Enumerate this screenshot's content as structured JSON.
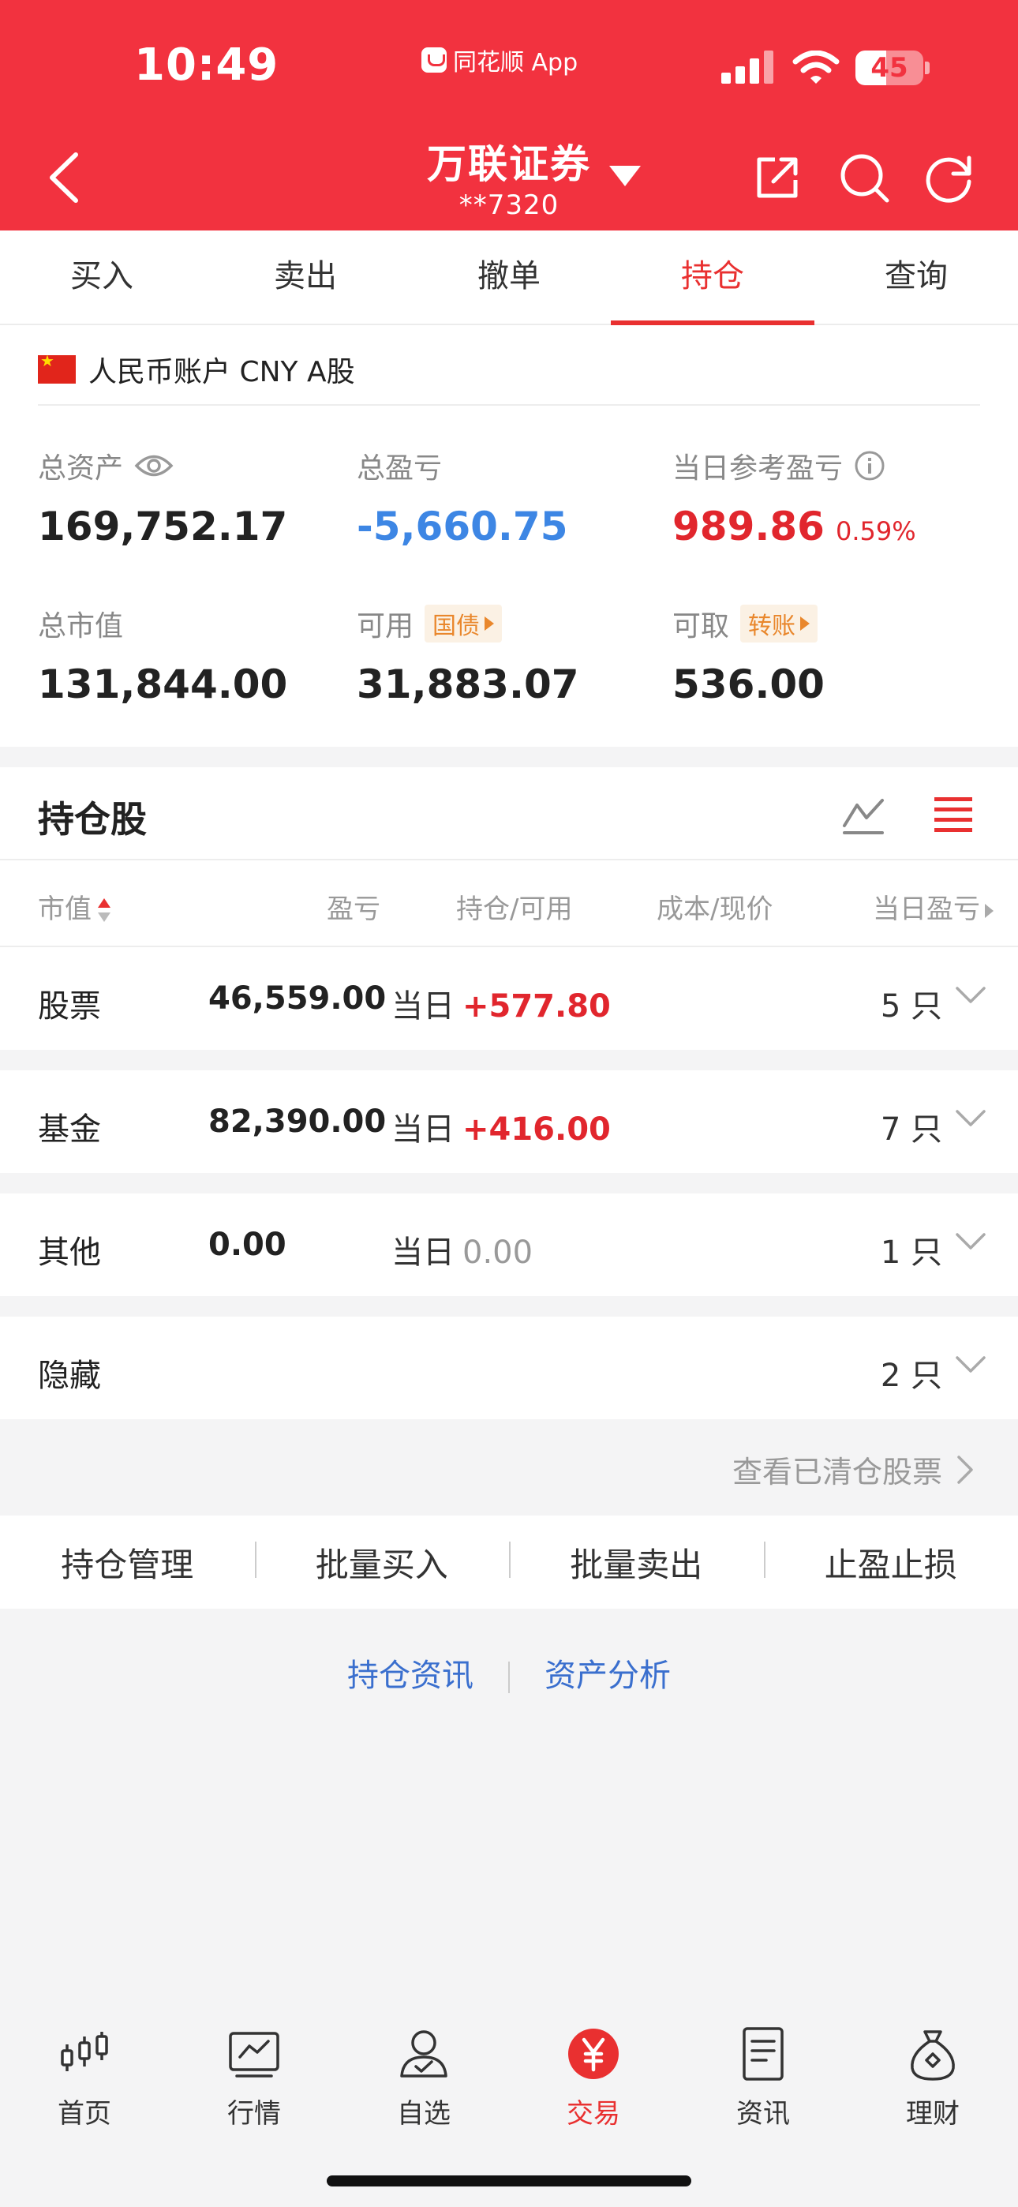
{
  "status_bar": {
    "time": "10:49",
    "app_label": "同花顺 App",
    "battery": "45",
    "battery_fraction": 0.45
  },
  "header": {
    "broker_name": "万联证券",
    "account_masked": "**7320"
  },
  "tabs": [
    {
      "label": "买入"
    },
    {
      "label": "卖出"
    },
    {
      "label": "撤单"
    },
    {
      "label": "持仓",
      "active": true
    },
    {
      "label": "查询"
    }
  ],
  "account": {
    "currency_line": "人民币账户 CNY A股",
    "total_assets": {
      "label": "总资产",
      "value": "169,752.17"
    },
    "total_pnl": {
      "label": "总盈亏",
      "value": "-5,660.75"
    },
    "daily_pnl": {
      "label": "当日参考盈亏",
      "value": "989.86",
      "pct": "0.59%"
    },
    "market_value": {
      "label": "总市值",
      "value": "131,844.00"
    },
    "available": {
      "label": "可用",
      "tag": "国债",
      "value": "31,883.07"
    },
    "withdrawable": {
      "label": "可取",
      "tag": "转账",
      "value": "536.00"
    }
  },
  "holdings": {
    "title": "持仓股",
    "columns": [
      "市值",
      "盈亏",
      "持仓/可用",
      "成本/现价",
      "当日盈亏"
    ],
    "categories": [
      {
        "name": "股票",
        "value": "46,559.00",
        "day_label": "当日",
        "day_value": "+577.80",
        "count": "5 只"
      },
      {
        "name": "基金",
        "value": "82,390.00",
        "day_label": "当日",
        "day_value": "+416.00",
        "count": "7 只"
      },
      {
        "name": "其他",
        "value": "0.00",
        "day_label": "当日",
        "day_value": "0.00",
        "count": "1 只"
      },
      {
        "name": "隐藏",
        "count": "2 只"
      }
    ],
    "cleared_link": "查看已清仓股票"
  },
  "actions": [
    "持仓管理",
    "批量买入",
    "批量卖出",
    "止盈止损"
  ],
  "info_links": [
    "持仓资讯",
    "资产分析"
  ],
  "tabbar": [
    {
      "label": "首页",
      "icon": "candlestick-icon"
    },
    {
      "label": "行情",
      "icon": "chart-icon"
    },
    {
      "label": "自选",
      "icon": "user-check-icon"
    },
    {
      "label": "交易",
      "icon": "yuan-icon",
      "active": true
    },
    {
      "label": "资讯",
      "icon": "document-icon"
    },
    {
      "label": "理财",
      "icon": "money-bag-icon"
    }
  ],
  "colors": {
    "brand_red": "#f2323f",
    "profit_red": "#e1262d",
    "loss_blue": "#3d86e4",
    "tag_orange": "#e9872c"
  }
}
